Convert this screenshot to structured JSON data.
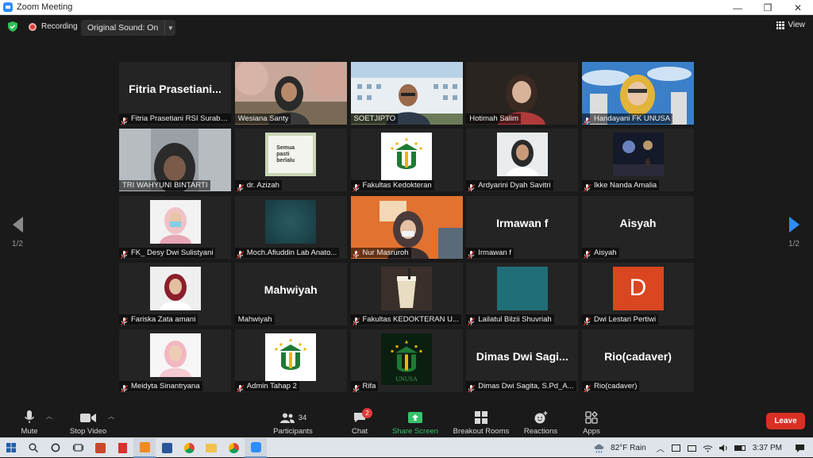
{
  "window": {
    "title": "Zoom Meeting",
    "controls": [
      "—",
      "❐",
      "✕"
    ]
  },
  "topbar": {
    "recording_label": "Recording",
    "original_sound_label": "Original Sound: On",
    "view_label": "View"
  },
  "pager": {
    "left": "1/2",
    "right": "1/2"
  },
  "tiles": [
    {
      "display": "Fitria  Prasetiani...",
      "label": "Fitria Prasetiani RSI Suraba...",
      "muted": true,
      "kind": "name"
    },
    {
      "label": "Wesiana Santy",
      "muted": false,
      "kind": "video-trees"
    },
    {
      "label": "SOETJIPTO",
      "muted": false,
      "kind": "video-building"
    },
    {
      "label": "Hotimah Salim",
      "muted": false,
      "kind": "video-hijab-dark"
    },
    {
      "label": "Handayani FK UNUSA",
      "muted": true,
      "kind": "video-sky"
    },
    {
      "label": "TRI WAHYUNI BINTARTI",
      "muted": false,
      "kind": "video-blur",
      "active": true
    },
    {
      "label": "dr. Azizah",
      "muted": true,
      "kind": "thumb-text",
      "thumb_text": "Semua pasti berlalu"
    },
    {
      "label": "Fakultas Kedokteran",
      "muted": true,
      "kind": "thumb-logo-white"
    },
    {
      "label": "Ardyarini Dyah Savitri",
      "muted": true,
      "kind": "thumb-portrait"
    },
    {
      "label": "Ikke Nanda Amalia",
      "muted": true,
      "kind": "thumb-night"
    },
    {
      "label": "FK_ Desy Dwi Sulistyani",
      "muted": true,
      "kind": "thumb-mask"
    },
    {
      "label": "Moch.Afiuddin Lab Anato...",
      "muted": true,
      "kind": "thumb-teal"
    },
    {
      "label": "Nur Masruroh",
      "muted": true,
      "kind": "video-orange"
    },
    {
      "display": "Irmawan f",
      "label": "Irmawan f",
      "muted": true,
      "kind": "name"
    },
    {
      "display": "Aisyah",
      "label": "Aisyah",
      "muted": true,
      "kind": "name"
    },
    {
      "label": "Fariska Zata amani",
      "muted": true,
      "kind": "thumb-hijab-red"
    },
    {
      "display": "Mahwiyah",
      "label": "Mahwiyah",
      "muted": false,
      "kind": "name"
    },
    {
      "label": "Fakultas KEDOKTERAN U...",
      "muted": true,
      "kind": "thumb-drink"
    },
    {
      "label": "Lailatul Bilzii Shuvriah",
      "muted": true,
      "kind": "thumb-teal-solid"
    },
    {
      "label": "Dwi Lestari Pertiwi",
      "muted": true,
      "kind": "thumb-letter",
      "thumb_text": "D"
    },
    {
      "label": "Meidyta Sinantryana",
      "muted": true,
      "kind": "thumb-hijab-pink"
    },
    {
      "label": "Admin Tahap 2",
      "muted": true,
      "kind": "thumb-logo-white"
    },
    {
      "label": "Rifa",
      "muted": true,
      "kind": "thumb-logo-dark",
      "thumb_text": "UNUSA"
    },
    {
      "display": "Dimas  Dwi  Sagi...",
      "label": "Dimas Dwi Sagita, S.Pd_A...",
      "muted": true,
      "kind": "name"
    },
    {
      "display": "Rio(cadaver)",
      "label": "Rio(cadaver)",
      "muted": true,
      "kind": "name"
    }
  ],
  "toolbar": {
    "mute": "Mute",
    "stop_video": "Stop Video",
    "participants": "Participants",
    "participants_count": "34",
    "chat": "Chat",
    "chat_badge": "2",
    "share_screen": "Share Screen",
    "breakout_rooms": "Breakout Rooms",
    "reactions": "Reactions",
    "apps": "Apps",
    "leave": "Leave"
  },
  "taskbar": {
    "weather": "82°F  Rain",
    "time": "3:37 PM"
  },
  "colors": {
    "accent": "#2d8cff",
    "share_green": "#37c26b",
    "leave_red": "#d93025",
    "active_border": "#e8e35f"
  }
}
